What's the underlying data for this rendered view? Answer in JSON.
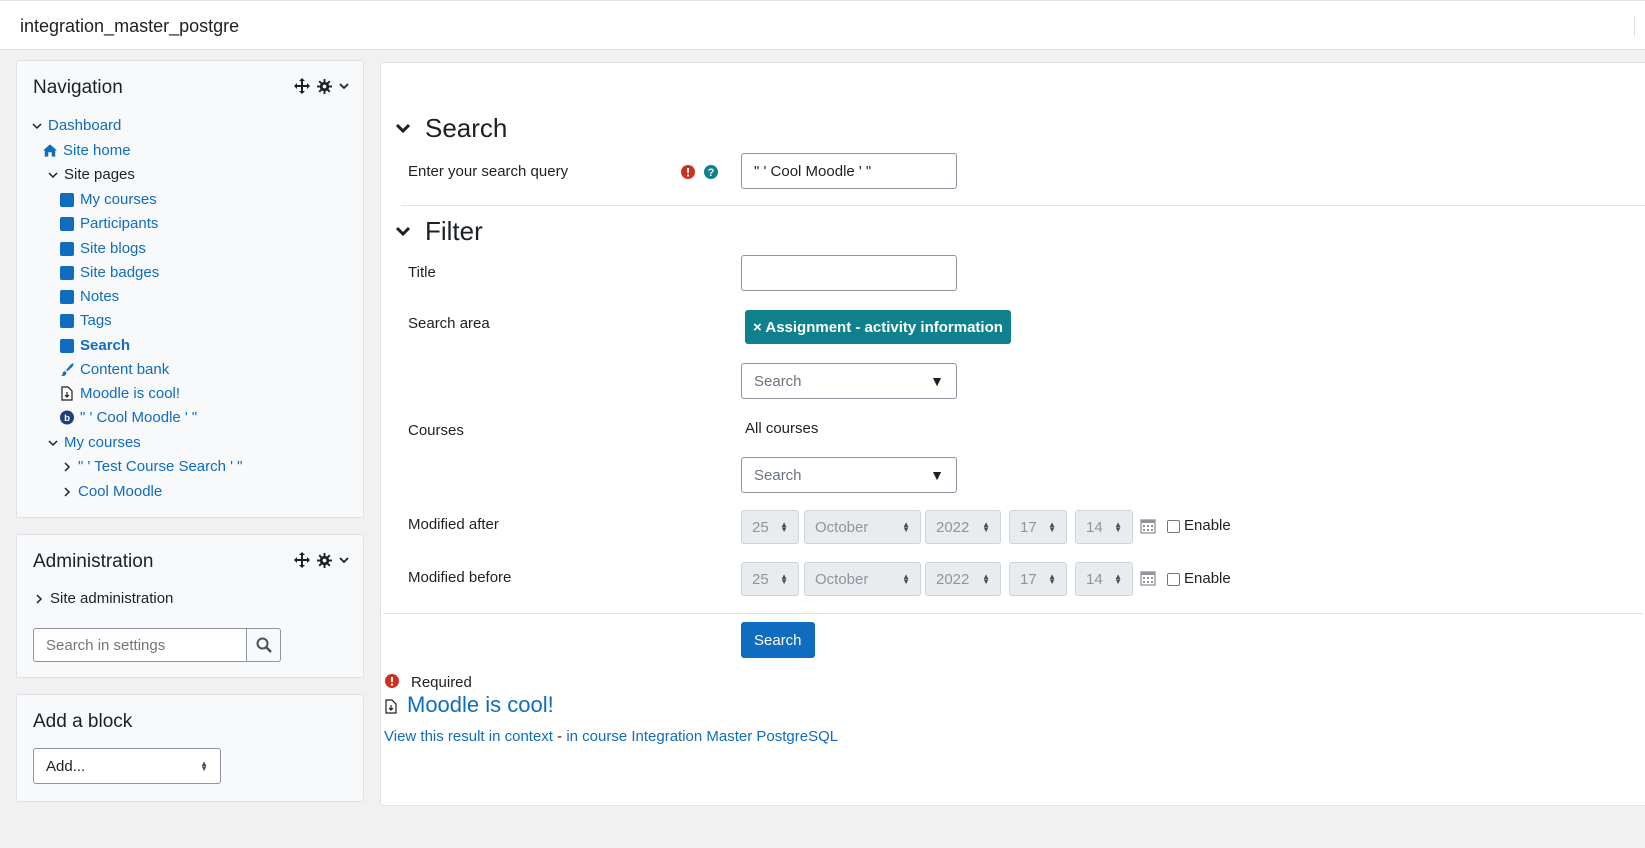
{
  "topbar": {
    "site_name": "integration_master_postgre"
  },
  "navigation": {
    "title": "Navigation",
    "dashboard": "Dashboard",
    "site_home": "Site home",
    "site_pages": "Site pages",
    "pages": [
      "My courses",
      "Participants",
      "Site blogs",
      "Site badges",
      "Notes",
      "Tags",
      "Search"
    ],
    "content_bank": "Content bank",
    "moodle_is_cool": "Moodle is cool!",
    "cool_moodle": "\" ' Cool Moodle ' \"",
    "my_courses": "My courses",
    "courses": [
      "\" ' Test Course Search ' \"",
      "Cool Moodle"
    ]
  },
  "administration": {
    "title": "Administration",
    "site_admin": "Site administration",
    "search_placeholder": "Search in settings"
  },
  "add_block": {
    "title": "Add a block",
    "select_value": "Add..."
  },
  "search_section": {
    "legend": "Search",
    "query_label": "Enter your search query",
    "query_value": "\" ' Cool Moodle ' \""
  },
  "filter_section": {
    "legend": "Filter",
    "title_label": "Title",
    "title_value": "",
    "search_area_label": "Search area",
    "search_area_tag": "× Assignment - activity information",
    "search_area_combo_placeholder": "Search",
    "courses_label": "Courses",
    "courses_value": "All courses",
    "courses_combo_placeholder": "Search",
    "modified_after": {
      "label": "Modified after",
      "day": "25",
      "month": "October",
      "year": "2022",
      "hour": "17",
      "minute": "14",
      "enable_label": "Enable"
    },
    "modified_before": {
      "label": "Modified before",
      "day": "25",
      "month": "October",
      "year": "2022",
      "hour": "17",
      "minute": "14",
      "enable_label": "Enable"
    },
    "submit_label": "Search"
  },
  "required_note": "Required",
  "result": {
    "title": "Moodle is cool!",
    "context_link": "View this result in context",
    "separator": " - ",
    "course_link": "in course Integration Master PostgreSQL"
  },
  "colors": {
    "link": "#0f6cbf",
    "tag": "#0f818c",
    "required": "#ca3120",
    "help": "#0f818c"
  }
}
